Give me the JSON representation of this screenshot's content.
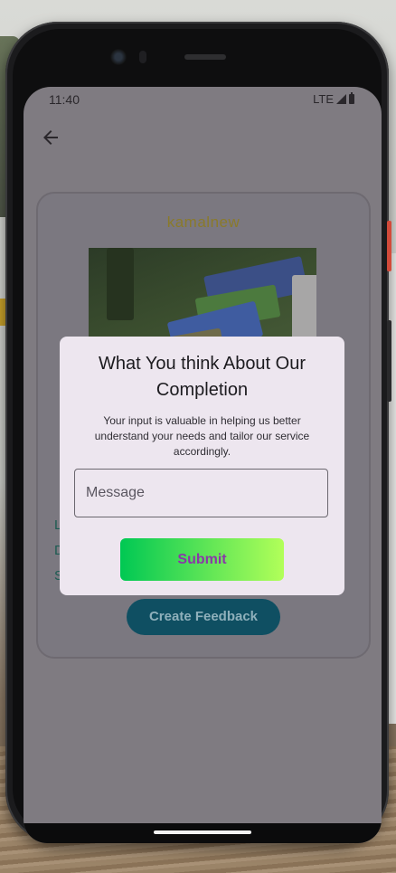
{
  "status_bar": {
    "time": "11:40",
    "network": "LTE"
  },
  "icons": {
    "back": "arrow-left-icon",
    "signal": "signal-icon",
    "battery": "battery-icon"
  },
  "card": {
    "title": "kamalnew",
    "peek_letters": [
      "L",
      "D",
      "S"
    ],
    "button_label": "Create Feedback"
  },
  "dialog": {
    "title": "What You think About Our Completion",
    "body": "Your input is valuable in helping us better understand  your needs and tailor our service accordingly.",
    "message_placeholder": "Message",
    "submit_label": "Submit"
  },
  "colors": {
    "accent_gradient_start": "#00c853",
    "accent_gradient_end": "#b2ff59",
    "submit_text": "#8a38a8",
    "dialog_bg": "#ede6ef",
    "scrim": "#7f7b81"
  }
}
